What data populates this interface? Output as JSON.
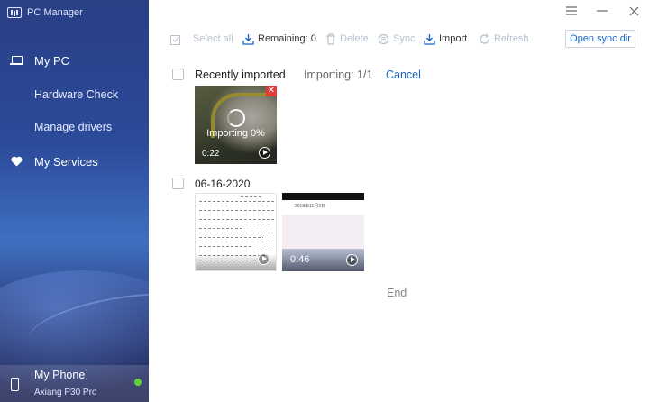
{
  "app": {
    "title": "PC Manager"
  },
  "sidebar": {
    "items": [
      {
        "label": "My PC",
        "icon": "laptop-icon"
      },
      {
        "label": "Hardware Check"
      },
      {
        "label": "Manage drivers"
      },
      {
        "label": "My Services",
        "icon": "heart-icon"
      }
    ],
    "phone": {
      "name": "My Phone",
      "model": "Axiang P30 Pro",
      "status_color": "#5fd13c"
    }
  },
  "toolbar": {
    "select_all": "Select all",
    "remaining": "Remaining: 0",
    "delete": "Delete",
    "sync": "Sync",
    "import": "Import",
    "refresh": "Refresh",
    "open_sync_dir": "Open sync dir"
  },
  "content": {
    "recent": {
      "title": "Recently imported",
      "status": "Importing: 1/1",
      "cancel": "Cancel",
      "items": [
        {
          "type": "video",
          "progress_label": "Importing 0%",
          "progress": 0,
          "duration": "0:22"
        }
      ]
    },
    "group": {
      "date": "06-16-2020",
      "items": [
        {
          "type": "video",
          "kind": "document-screenshot"
        },
        {
          "type": "video",
          "kind": "phone-screenshot",
          "duration": "0:46",
          "caption": "2018年11月2日"
        }
      ]
    },
    "end": "End"
  },
  "colors": {
    "accent": "#1a66c8",
    "sidebar": "#2b4a98",
    "error": "#e53a3a"
  }
}
